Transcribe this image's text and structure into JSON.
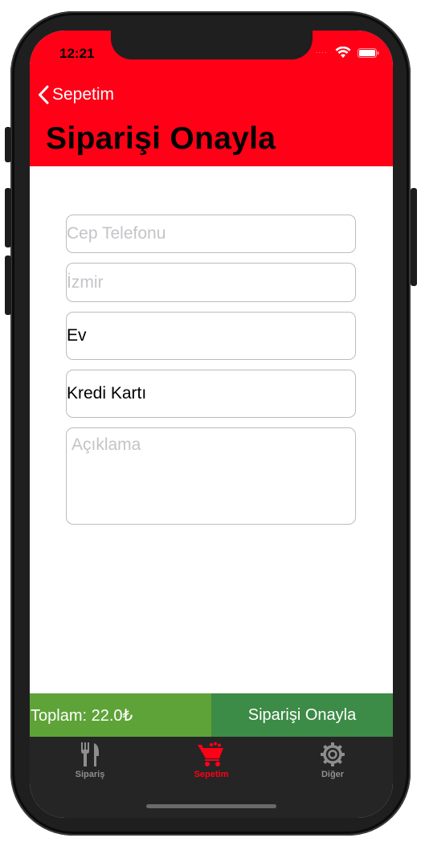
{
  "status": {
    "time": "12:21",
    "dots": "····"
  },
  "nav": {
    "back_label": "Sepetim",
    "title": "Siparişi Onayla"
  },
  "form": {
    "phone_placeholder": "Cep Telefonu",
    "city_placeholder": "İzmir",
    "address_value": "Ev",
    "payment_value": "Kredi Kartı",
    "note_placeholder": "Açıklama"
  },
  "footer": {
    "total_label": "Toplam: 22.0₺",
    "confirm_label": "Siparişi Onayla"
  },
  "tabs": [
    {
      "label": "Sipariş",
      "icon": "fork-knife-icon",
      "active": false
    },
    {
      "label": "Sepetim",
      "icon": "cart-icon",
      "active": true
    },
    {
      "label": "Diğer",
      "icon": "gear-icon",
      "active": false
    }
  ],
  "colors": {
    "header": "#ff0016",
    "total_bg": "#5ea337",
    "confirm_bg": "#3c8b46",
    "tab_active": "#ff0016",
    "tab_inactive": "#8e8e8e"
  }
}
